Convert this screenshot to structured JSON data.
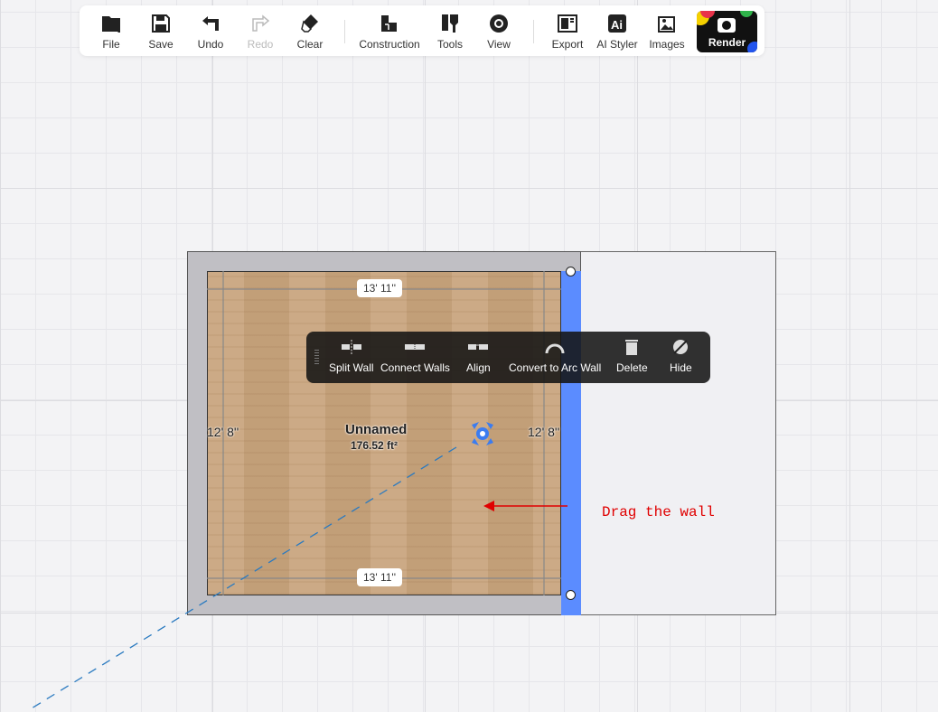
{
  "toolbar": {
    "items": [
      {
        "label": "File",
        "icon": "folder-icon"
      },
      {
        "label": "Save",
        "icon": "save-icon"
      },
      {
        "label": "Undo",
        "icon": "undo-icon"
      },
      {
        "label": "Redo",
        "icon": "redo-icon",
        "disabled": true
      },
      {
        "label": "Clear",
        "icon": "eraser-icon"
      },
      {
        "label": "Construction",
        "icon": "construction-icon"
      },
      {
        "label": "Tools",
        "icon": "tools-icon"
      },
      {
        "label": "View",
        "icon": "eye-icon"
      },
      {
        "label": "Export",
        "icon": "export-icon"
      },
      {
        "label": "AI Styler",
        "icon": "ai-styler-icon"
      },
      {
        "label": "Images",
        "icon": "images-icon"
      }
    ],
    "render_label": "Render"
  },
  "room": {
    "name": "Unnamed",
    "area": "176.52 ft²",
    "dim_top": "13' 11''",
    "dim_bottom": "13' 11''",
    "dim_left": "12' 8''",
    "dim_right": "12' 8''"
  },
  "context_menu": {
    "items": [
      {
        "label": "Split Wall"
      },
      {
        "label": "Connect Walls"
      },
      {
        "label": "Align"
      },
      {
        "label": "Convert to Arc Wall"
      },
      {
        "label": "Delete"
      },
      {
        "label": "Hide"
      }
    ]
  },
  "annotation": {
    "text": "Drag the wall",
    "color": "#e00000"
  },
  "colors": {
    "selected_wall": "#5b8cff",
    "wall": "#c0bfc4"
  }
}
